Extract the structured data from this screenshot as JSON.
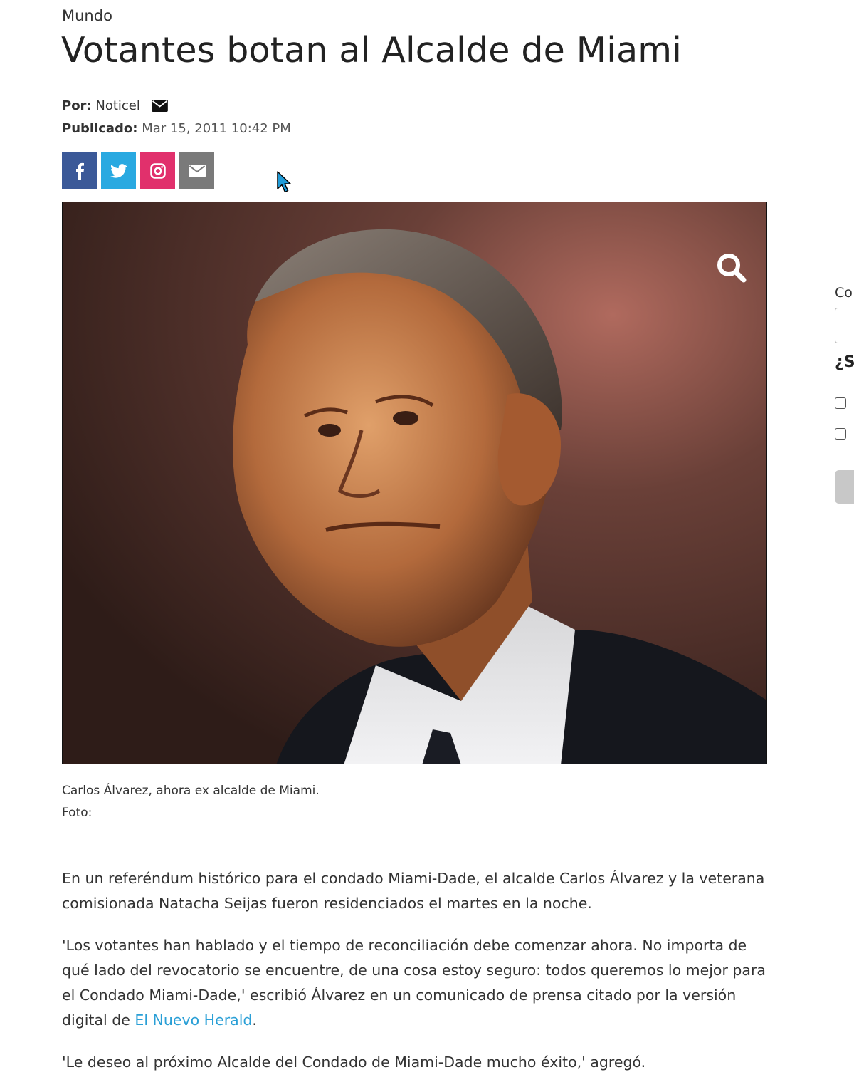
{
  "article": {
    "category": "Mundo",
    "title": "Votantes botan al Alcalde de Miami",
    "author_label": "Por:",
    "author": "Noticel",
    "published_label": "Publicado:",
    "published": "Mar 15, 2011 10:42 PM",
    "caption": "Carlos Álvarez, ahora ex alcalde de Miami.",
    "photo_credit": "Foto:",
    "paragraphs": {
      "p1": "En un referéndum histórico para el condado Miami-Dade, el alcalde Carlos Álvarez y la veterana comisionada Natacha Seijas fueron residenciados el martes en la noche.",
      "p2": "'Los votantes han hablado y el tiempo de reconciliación debe comenzar ahora. No importa de qué lado del revocatorio se encuentre, de una cosa estoy seguro: todos queremos lo mejor para el Condado Miami-Dade,' escribió Álvarez en un comunicado de prensa citado por la versión digital de ",
      "p2_link": "El Nuevo Herald",
      "p2_end": ".",
      "p3": "'Le deseo al próximo Alcalde del Condado de Miami-Dade mucho éxito,' agregó."
    }
  },
  "share": {
    "facebook_color": "#3b5998",
    "twitter_color": "#29a9e1",
    "instagram_color": "#e1306c",
    "email_color": "#7a7a7a"
  },
  "sidebar": {
    "label_fragment": "Co",
    "question_fragment": "¿S"
  },
  "colors": {
    "link": "#2a9fd6",
    "text": "#333333"
  }
}
